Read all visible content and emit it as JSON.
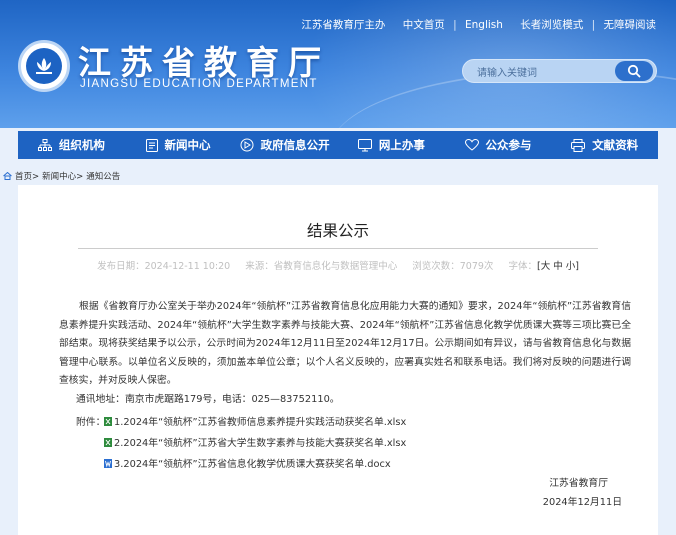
{
  "toplinks": {
    "sponsor": "江苏省教育厅主办",
    "home": "中文首页",
    "english": "English",
    "elder": "长者浏览模式",
    "accessible": "无障碍阅读"
  },
  "site": {
    "title_cn": "江苏省教育厅",
    "title_en": "JIANGSU EDUCATION DEPARTMENT"
  },
  "search": {
    "placeholder": "请输入关键词"
  },
  "nav": [
    {
      "label": "组织机构",
      "icon": "org-chart-icon"
    },
    {
      "label": "新闻中心",
      "icon": "news-icon"
    },
    {
      "label": "政府信息公开",
      "icon": "info-disclosure-icon"
    },
    {
      "label": "网上办事",
      "icon": "monitor-icon"
    },
    {
      "label": "公众参与",
      "icon": "heart-icon"
    },
    {
      "label": "文献资料",
      "icon": "printer-icon"
    }
  ],
  "breadcrumb": [
    "首页>",
    "新闻中心>",
    "通知公告"
  ],
  "article": {
    "title": "结果公示",
    "publish_date": "发布日期：2024-12-11 10:20",
    "source": "来源：省教育信息化与数据管理中心",
    "views": "浏览次数：7079次",
    "font_label": "字体：",
    "font_sizes": "[大 中 小]",
    "body": "根据《省教育厅办公室关于举办2024年“领航杯”江苏省教育信息化应用能力大赛的通知》要求，2024年“领航杯”江苏省教育信息素养提升实践活动、2024年“领航杯”大学生数字素养与技能大赛、2024年“领航杯”江苏省信息化教学优质课大赛等三项比赛已全部结束。现将获奖结果予以公示，公示时间为2024年12月11日至2024年12月17日。公示期间如有异议，请与省教育信息化与数据管理中心联系。以单位名义反映的，须加盖本单位公章；以个人名义反映的，应署真实姓名和联系电话。我们将对反映的问题进行调查核实，并对反映人保密。",
    "address": "通讯地址：南京市虎踞路179号，电话：025—83752110。",
    "attachments_label": "附件：",
    "attachments": [
      {
        "name": "1.2024年“领航杯”江苏省教师信息素养提升实践活动获奖名单.xlsx",
        "type": "xlsx"
      },
      {
        "name": "2.2024年“领航杯”江苏省大学生数字素养与技能大赛获奖名单.xlsx",
        "type": "xlsx"
      },
      {
        "name": "3.2024年“领航杯”江苏省信息化教学优质课大赛获奖名单.docx",
        "type": "docx"
      }
    ],
    "signature_org": "江苏省教育厅",
    "signature_date": "2024年12月11日"
  },
  "colors": {
    "header_blue": "#1f65c4",
    "nav_blue": "#1e63c2",
    "page_bg": "#e8f0fb",
    "xlsx_green": "#2e8b3d",
    "docx_blue": "#2b6fd1"
  }
}
